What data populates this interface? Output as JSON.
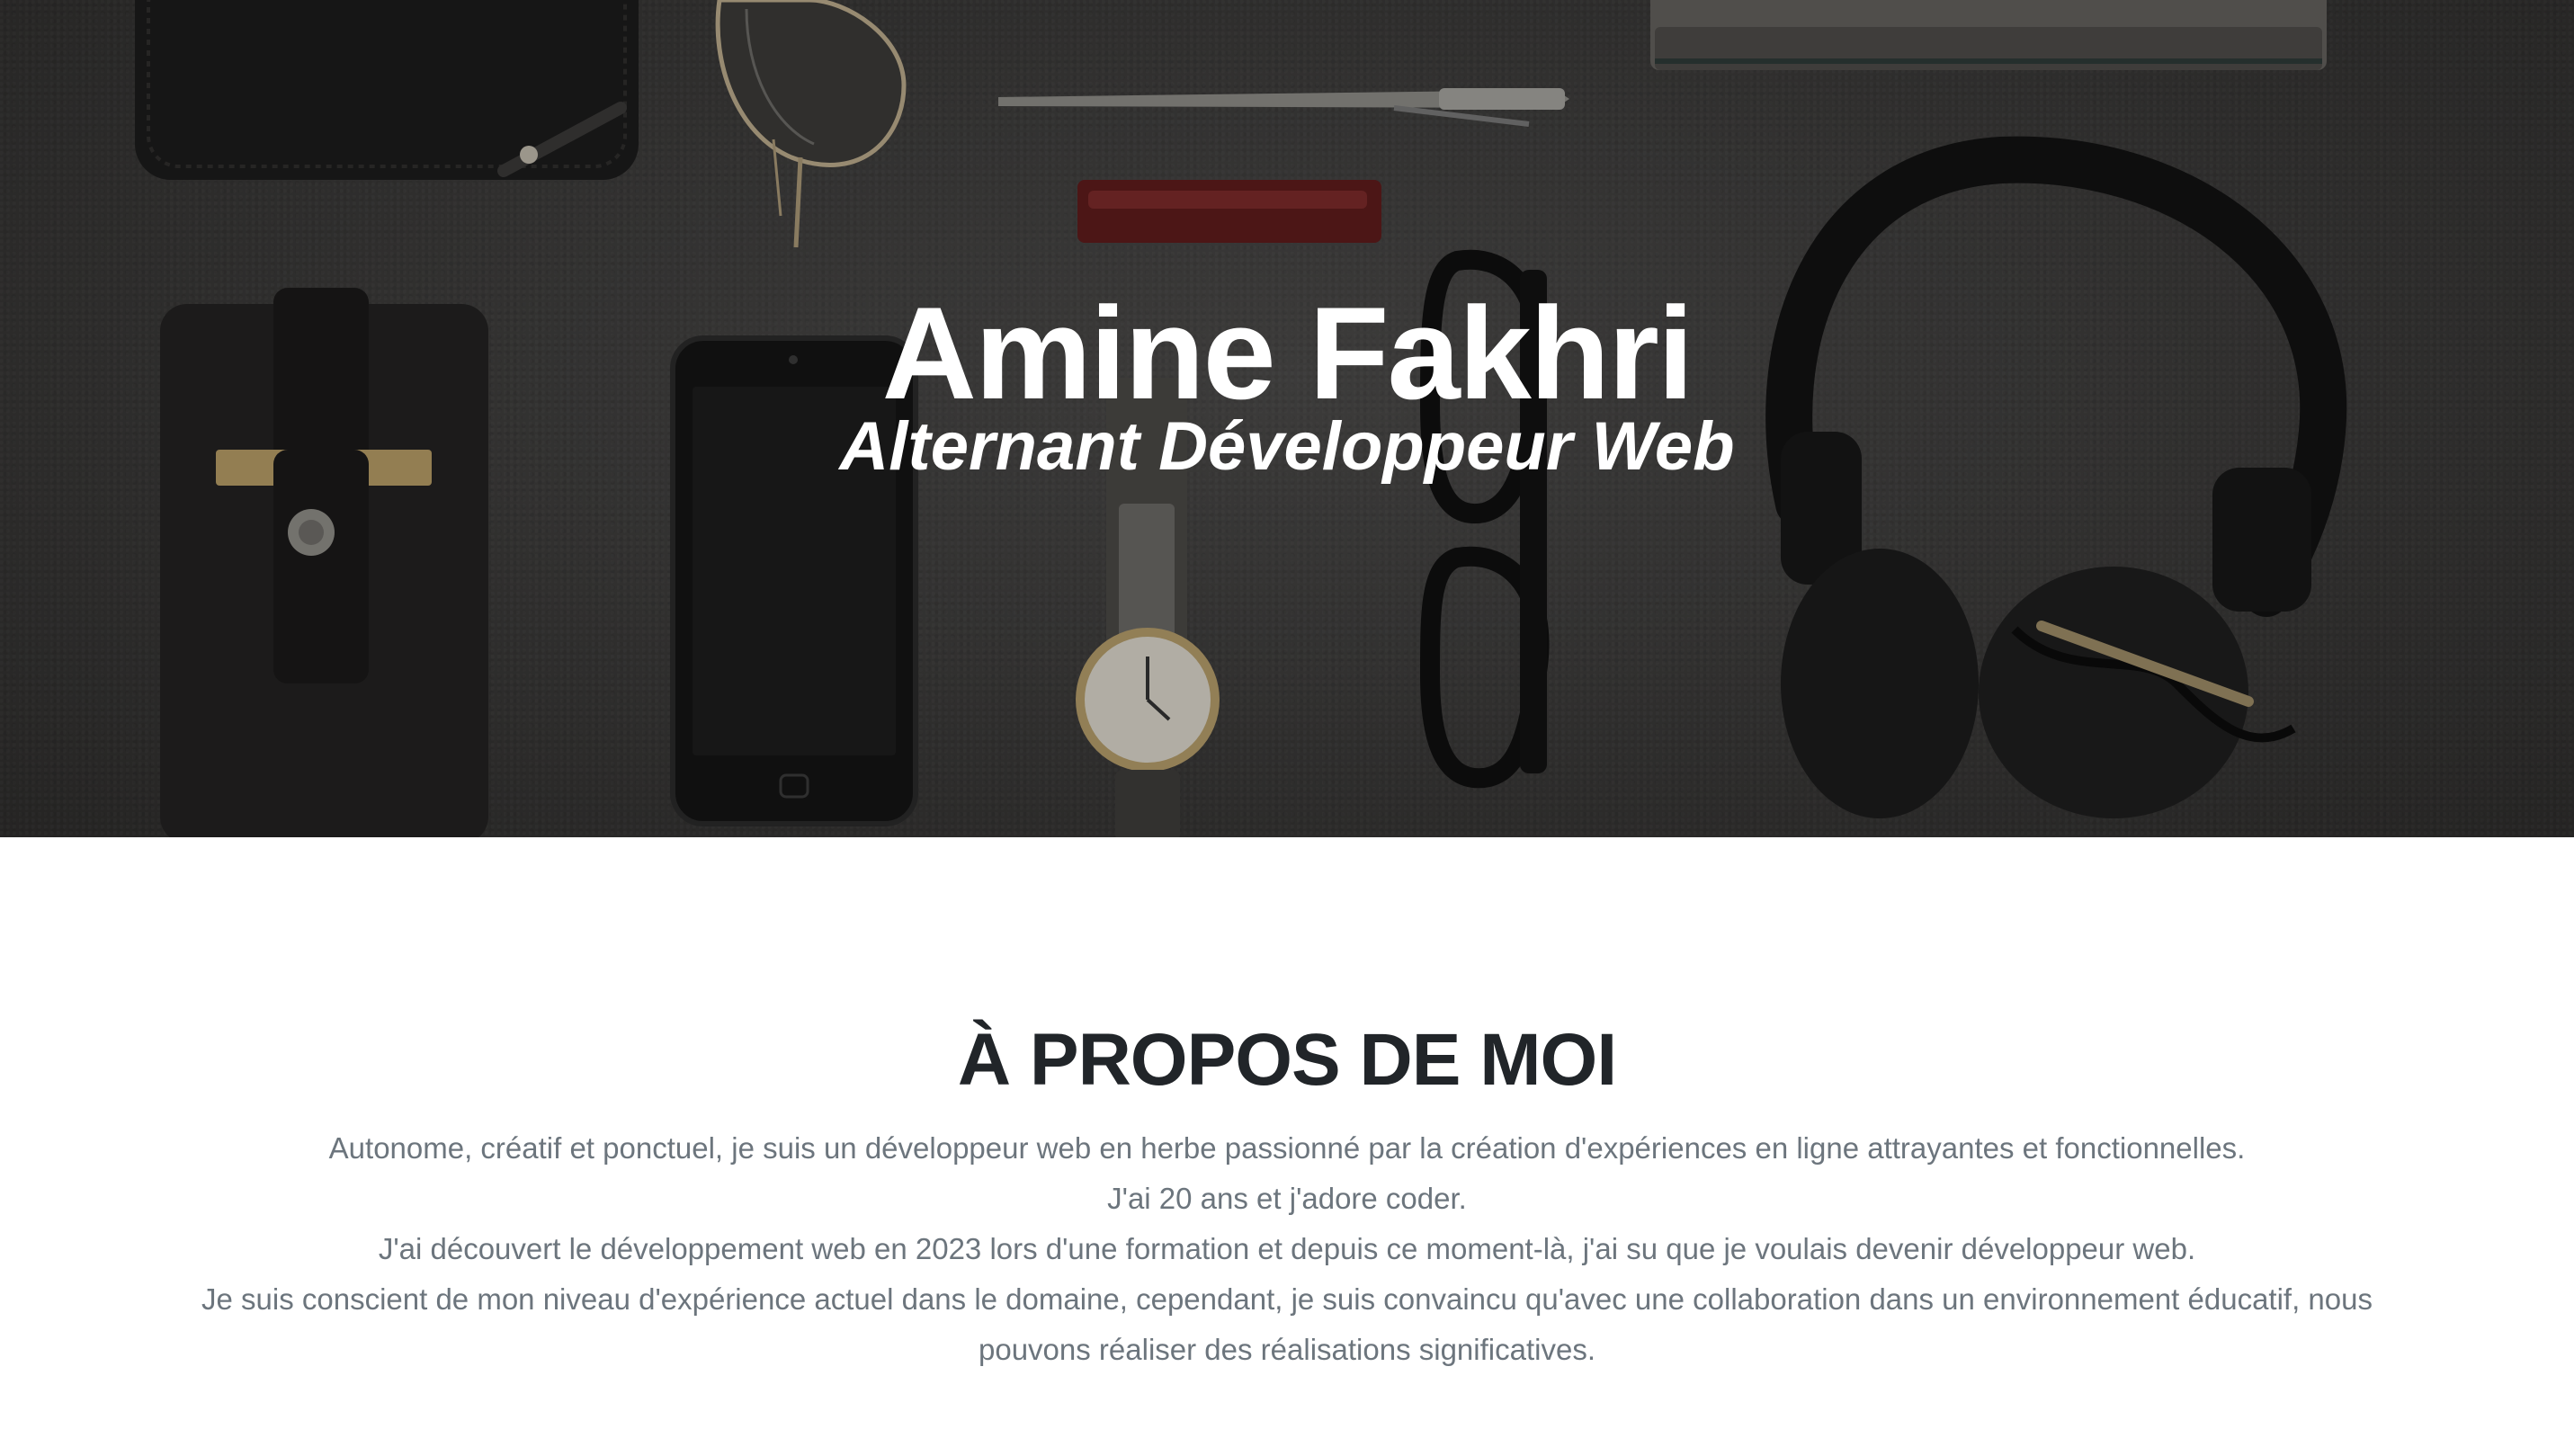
{
  "hero": {
    "name": "Amine Fakhri",
    "subtitle": "Alternant Développeur Web"
  },
  "about": {
    "heading": "À PROPOS DE MOI",
    "lines": [
      "Autonome, créatif et ponctuel, je suis un développeur web en herbe passionné par la création d'expériences en ligne attrayantes et fonctionnelles.",
      "J'ai 20 ans et j'adore coder.",
      "J'ai découvert le développement web en 2023 lors d'une formation et depuis ce moment-là, j'ai su que je voulais devenir développeur web.",
      "Je suis conscient de mon niveau d'expérience actuel dans le domaine, cependant, je suis convaincu qu'avec une collaboration dans un environnement éducatif, nous pouvons réaliser des réalisations significatives."
    ]
  },
  "colors": {
    "hero_text": "#ffffff",
    "heading": "#212529",
    "body_text": "#6c757d"
  }
}
